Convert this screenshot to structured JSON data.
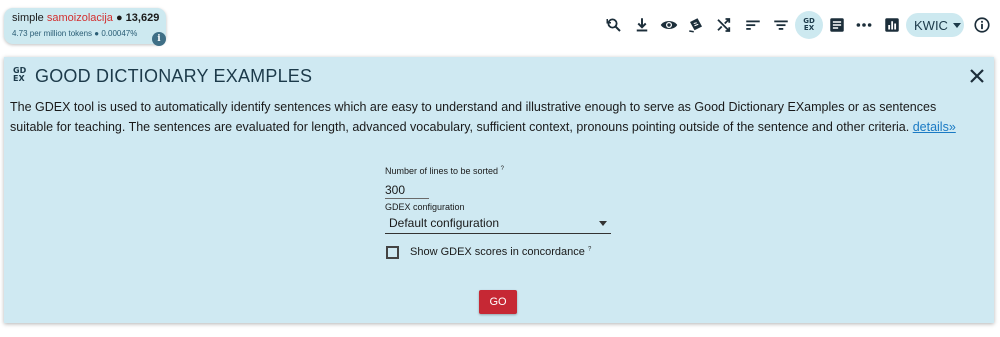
{
  "query": {
    "prefix": "simple",
    "word": "samoizolacija",
    "separator": "●",
    "count": "13,629",
    "stats": "4.73 per million tokens ● 0.00047%",
    "info_glyph": "i"
  },
  "toolbar": {
    "icons": [
      "search-refine-icon",
      "download-icon",
      "eye-icon",
      "bookmark-shuffle-icon",
      "shuffle-icon",
      "sort-icon",
      "filter-icon",
      "gdex-icon",
      "text-type-icon",
      "more-icon",
      "frequency-chart-icon",
      "view-mode",
      "info-icon"
    ],
    "gdex_top": "GD",
    "gdex_bottom": "EX",
    "view_mode": "KWIC"
  },
  "panel": {
    "icon_top": "GD",
    "icon_bottom": "EX",
    "title": "GOOD DICTIONARY EXAMPLES",
    "description": "The GDEX tool is used to automatically identify sentences which are easy to understand and illustrative enough to serve as Good Dictionary EXamples or as sentences suitable for teaching. The sentences are evaluated for length, advanced vocabulary, sufficient context, pronouns pointing outside of the sentence and other criteria.",
    "details_link": "details»",
    "lines_label": "Number of lines to be sorted",
    "help_mark": "?",
    "lines_value": "300",
    "config_label": "GDEX configuration",
    "config_value": "Default configuration",
    "checkbox_label": "Show GDEX scores in concordance",
    "go_label": "GO"
  },
  "colors": {
    "panel_bg": "#cfe9f2",
    "accent": "#cde9f0",
    "go_button": "#c62834",
    "query_word": "#d32f2f",
    "link": "#1a7ac4"
  }
}
